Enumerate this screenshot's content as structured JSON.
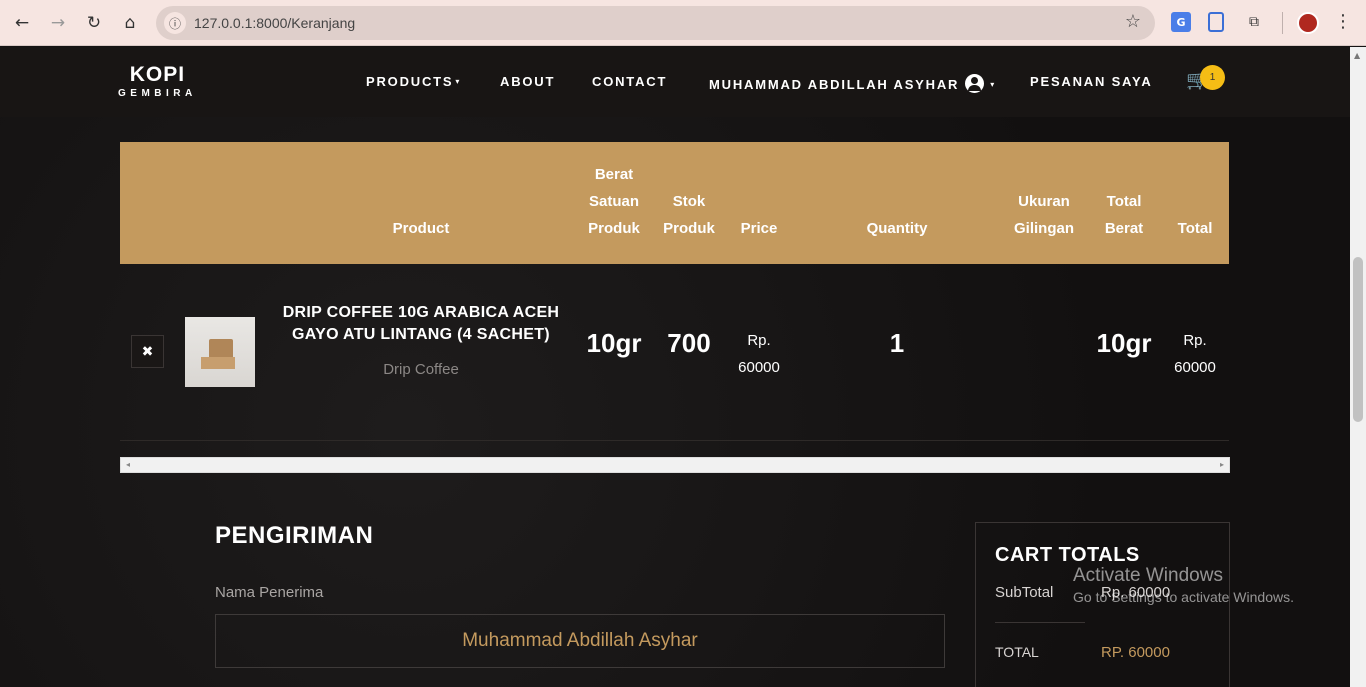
{
  "browser": {
    "url": "127.0.0.1:8000/Keranjang",
    "back_icon": "←",
    "forward_icon": "→",
    "reload_icon": "↻",
    "home_icon": "⌂",
    "info_icon": "ⓘ",
    "star_icon": "☆",
    "translate_icon": "G",
    "puzzle_icon": "⧉",
    "menu_icon": "⋮"
  },
  "navbar": {
    "brand_top": "KOPI",
    "brand_bottom": "GEMBIRA",
    "items": {
      "products": "PRODUCTS",
      "about": "ABOUT",
      "contact": "CONTACT",
      "user": "MUHAMMAD ABDILLAH ASYHAR",
      "orders": "PESANAN SAYA"
    },
    "caret": "▾",
    "cart_icon": "🛒",
    "cart_count": "1"
  },
  "table": {
    "headers": {
      "product": "Product",
      "berat": "Berat Satuan Produk",
      "stok": "Stok Produk",
      "price": "Price",
      "quantity": "Quantity",
      "ukuran": "Ukuran Gilingan",
      "total_berat": "Total Berat",
      "total": "Total"
    },
    "row": {
      "remove_icon": "✖",
      "name": "DRIP COFFEE 10G ARABICA ACEH GAYO ATU LINTANG (4 SACHET)",
      "category": "Drip Coffee",
      "berat": "10gr",
      "stok": "700",
      "price": "Rp. 60000",
      "quantity": "1",
      "ukuran": "",
      "total_berat": "10gr",
      "total": "Rp. 60000"
    },
    "scroll_left": "◂",
    "scroll_right": "▸"
  },
  "shipping": {
    "title": "PENGIRIMAN",
    "recipient_label": "Nama Penerima",
    "recipient_value": "Muhammad Abdillah Asyhar"
  },
  "totals": {
    "title": "CART TOTALS",
    "subtotal_label": "SubTotal",
    "subtotal_value": "Rp. 60000",
    "total_label": "TOTAL",
    "total_value": "RP. 60000"
  },
  "watermark": {
    "line1": "Activate Windows",
    "line2": "Go to Settings to activate Windows."
  },
  "colors": {
    "accent": "#c49a5e",
    "badge": "#f5bd15",
    "background": "#151313"
  }
}
